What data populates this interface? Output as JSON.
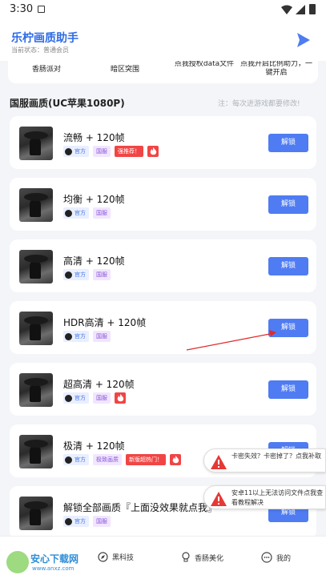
{
  "status_bar": {
    "time": "3:30"
  },
  "header": {
    "title": "乐柠画质助手",
    "status": "当前状态：普通会员"
  },
  "top_items": [
    "香肠派对",
    "暗区突围",
    "点我授权data文件",
    "点我开启比例助力，一键开启"
  ],
  "section": {
    "title": "国服画质(UC苹果1080P)",
    "note": "注：每次进游戏都要修改!"
  },
  "cards": [
    {
      "title": "流畅 + 120帧",
      "tags": [
        "官方",
        "国服",
        "强推荐！"
      ],
      "fire": true,
      "button": "解锁"
    },
    {
      "title": "均衡 + 120帧",
      "tags": [
        "官方",
        "国服"
      ],
      "fire": false,
      "button": "解锁"
    },
    {
      "title": "高清 + 120帧",
      "tags": [
        "官方",
        "国服"
      ],
      "fire": false,
      "button": "解锁"
    },
    {
      "title": "HDR高清 + 120帧",
      "tags": [
        "官方",
        "国服"
      ],
      "fire": false,
      "button": "解锁"
    },
    {
      "title": "超高清 + 120帧",
      "tags": [
        "官方",
        "国服"
      ],
      "fire": true,
      "button": "解锁"
    },
    {
      "title": "极清 + 120帧",
      "tags": [
        "官方",
        "极致画质",
        "新版超热门！"
      ],
      "fire": true,
      "button": "解锁"
    },
    {
      "title": "解锁全部画质『上面没效果就点我』",
      "tags": [
        "官方",
        "国服"
      ],
      "fire": false,
      "button": "解锁"
    }
  ],
  "toasts": [
    "卡密失效？卡密掉了？点我补取",
    "安卓11以上无法访问文件点我查看教程解决"
  ],
  "bottom_nav": [
    "黑科技",
    "香肠美化",
    "我的"
  ],
  "watermark": {
    "text": "安心下载网",
    "url": "www.anxz.com"
  },
  "colors": {
    "accent": "#4f7cf2",
    "title_blue": "#2e6be6",
    "hot_red": "#f14545",
    "purple_tag": "#8a55d6"
  }
}
